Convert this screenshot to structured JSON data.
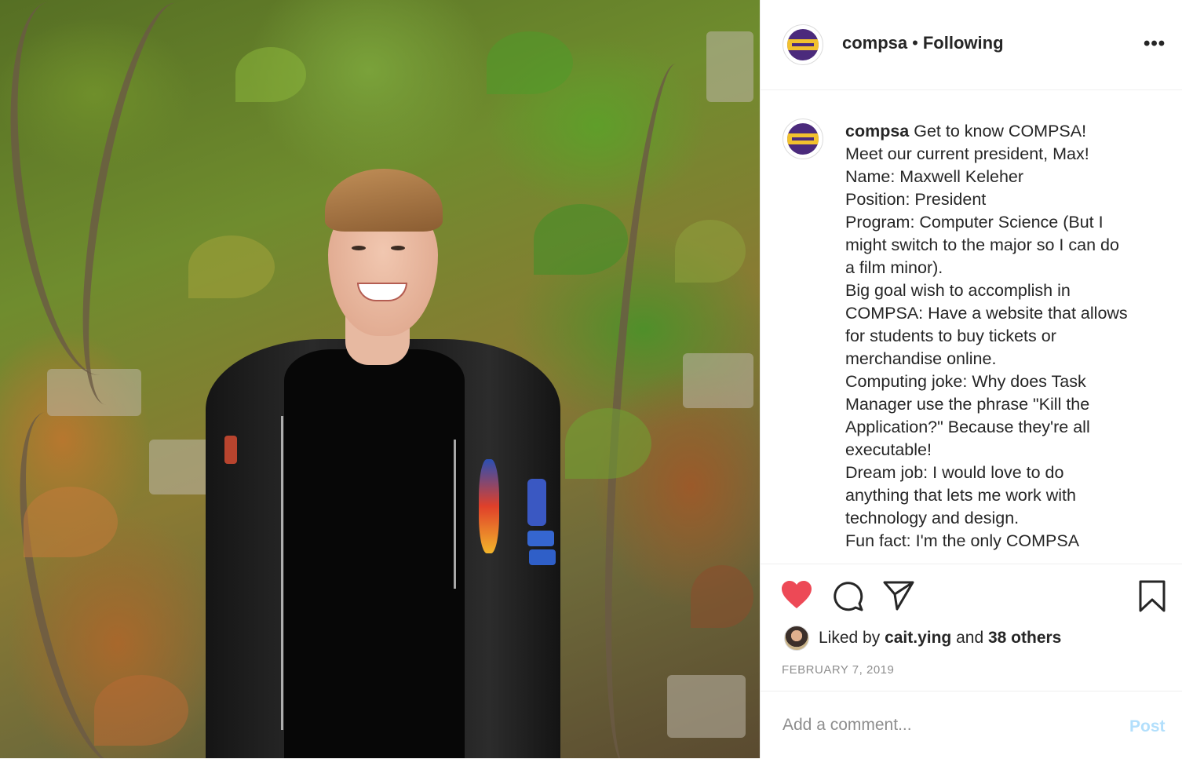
{
  "post": {
    "username": "compsa",
    "separator": "•",
    "follow_status": "Following",
    "more_label": "•••"
  },
  "caption": {
    "username": "compsa",
    "first_line": " Get to know COMPSA!",
    "lines": [
      "Meet our current president, Max!",
      "Name: Maxwell Keleher",
      "Position: President",
      "Program: Computer Science (But I",
      "might switch to the major so I can do",
      "a film minor).",
      "Big goal wish to accomplish in",
      "COMPSA: Have a website that allows",
      "for students to buy tickets or",
      "merchandise online.",
      "Computing joke: Why does Task",
      "Manager use the phrase \"Kill the",
      "Application?\" Because they're all",
      "executable!",
      "Dream job: I would love to do",
      "anything that lets me work with",
      "technology and design.",
      "Fun fact: I'm the only COMPSA"
    ]
  },
  "actions": {
    "icons": [
      "heart-icon",
      "comment-icon",
      "share-icon",
      "bookmark-icon"
    ],
    "like_color": "#ed4956"
  },
  "likes": {
    "prefix": "Liked by ",
    "user": "cait.ying",
    "middle": " and ",
    "others": "38 others"
  },
  "date": "FEBRUARY 7, 2019",
  "comment": {
    "placeholder": "Add a comment...",
    "post_label": "Post"
  },
  "colors": {
    "brand_purple": "#4b2a7c",
    "brand_gold": "#f2c12e",
    "post_disabled": "#b2dffc",
    "muted": "#8e8e8e"
  }
}
